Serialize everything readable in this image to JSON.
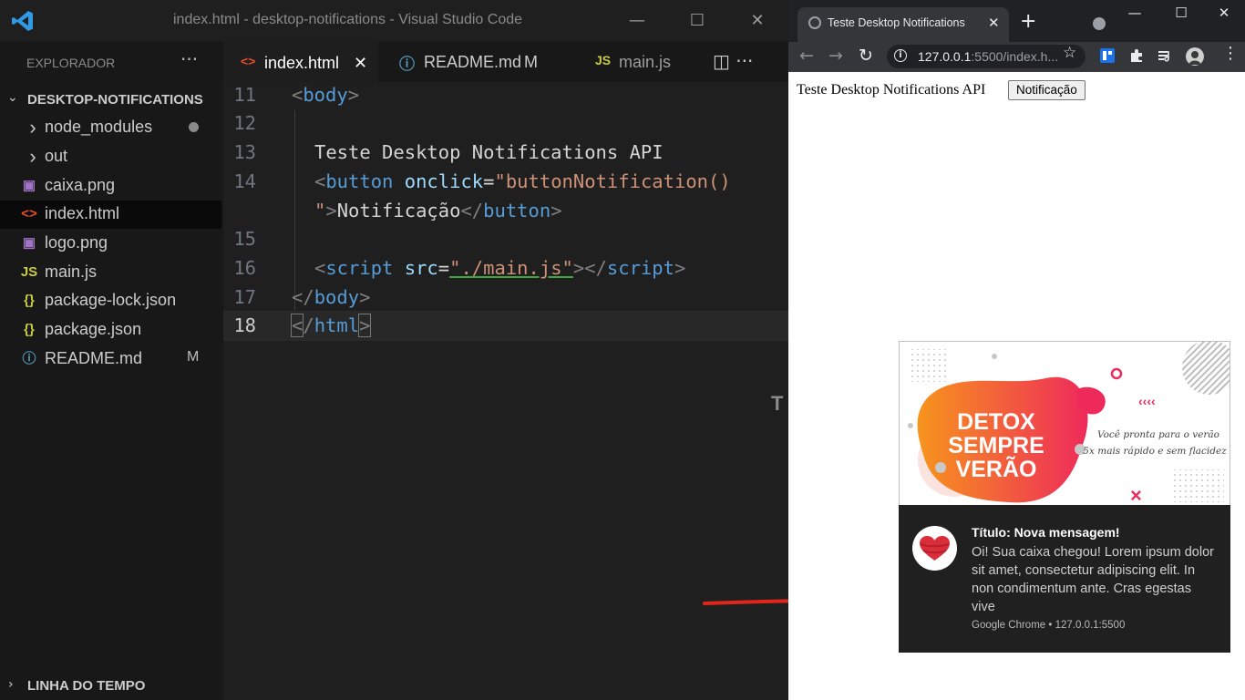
{
  "vscode": {
    "window_title": "index.html - desktop-notifications - Visual Studio Code",
    "controls": {
      "minimize": "—",
      "maximize": "☐",
      "close": "✕"
    },
    "explorer": {
      "title": "EXPLORADOR",
      "more": "···",
      "folder": "DESKTOP-NOTIFICATIONS",
      "items": [
        {
          "label": "node_modules",
          "icon": "chevron-right-icon",
          "glyph": "›",
          "color": "#cccccc"
        },
        {
          "label": "out",
          "icon": "chevron-right-icon",
          "glyph": "›",
          "color": "#cccccc"
        },
        {
          "label": "caixa.png",
          "icon": "image-file-icon",
          "glyph": "▣",
          "color": "#a074c4"
        },
        {
          "label": "index.html",
          "icon": "html-file-icon",
          "glyph": "<>",
          "color": "#e44d26"
        },
        {
          "label": "logo.png",
          "icon": "image-file-icon",
          "glyph": "▣",
          "color": "#a074c4"
        },
        {
          "label": "main.js",
          "icon": "js-file-icon",
          "glyph": "JS",
          "color": "#cbcb41"
        },
        {
          "label": "package-lock.json",
          "icon": "json-file-icon",
          "glyph": "{}",
          "color": "#cbcb41"
        },
        {
          "label": "package.json",
          "icon": "json-file-icon",
          "glyph": "{}",
          "color": "#cbcb41"
        },
        {
          "label": "README.md",
          "icon": "info-file-icon",
          "glyph": "ⓘ",
          "color": "#519aba",
          "badge": "M"
        }
      ],
      "timeline": "LINHA DO TEMPO"
    },
    "tabs": [
      {
        "label": "index.html",
        "glyph": "<>",
        "close": "✕"
      },
      {
        "label": "README.md",
        "glyph": "ⓘ",
        "badge": "M"
      },
      {
        "label": "main.js",
        "glyph": "JS"
      }
    ],
    "tab_actions": "◫ ···",
    "lines": [
      "11",
      "12",
      "13",
      "14",
      "15",
      "16",
      "17",
      "18"
    ],
    "code": {
      "l11": "body",
      "l13": "Teste Desktop Notifications API",
      "l14_tag": "button",
      "l14_attr": "onclick",
      "l14_val": "\"buttonNotification()",
      "l14b_quote": "\"",
      "l14b_text": "Notificação",
      "l16_tag": "script",
      "l16_attr": "src",
      "l16_val": "\"./main.js\"",
      "l17": "body",
      "l18": "html"
    },
    "truncated_char": "T"
  },
  "chrome": {
    "tab_title": "Teste Desktop Notifications",
    "tab_close": "✕",
    "new_tab": "+",
    "controls": {
      "minimize": "—",
      "maximize": "☐",
      "close": "✕"
    },
    "nav": {
      "back": "←",
      "forward": "→",
      "reload": "↻"
    },
    "url_host": "127.0.0.1",
    "url_rest": ":5500/index.h...",
    "star": "☆",
    "menu": "⋮",
    "page": {
      "text": "Teste Desktop Notifications API",
      "button": "Notificação"
    }
  },
  "notification": {
    "image_text": {
      "line1": "DETOX",
      "line2": "SEMPRE",
      "line3": "VERÃO",
      "tag1": "Você pronta para o verão",
      "tag2": "5x mais rápido e sem flacidez"
    },
    "title": "Título: Nova mensagem!",
    "message": "Oi! Sua caixa chegou! Lorem ipsum dolor sit amet, consectetur adipiscing elit. In non condimentum ante. Cras egestas vive",
    "source": "Google Chrome • 127.0.0.1:5500"
  }
}
